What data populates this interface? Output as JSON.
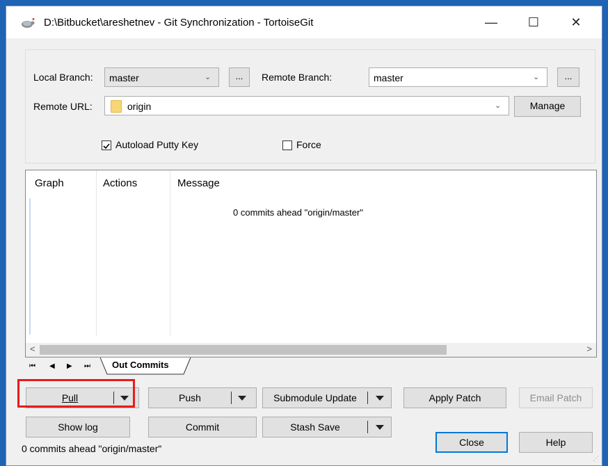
{
  "window": {
    "title": "D:\\Bitbucket\\areshetnev - Git Synchronization - TortoiseGit",
    "minimize_glyph": "—",
    "maximize_glyph": "☐",
    "close_glyph": "✕"
  },
  "form": {
    "local_branch_label": "Local Branch:",
    "local_branch_value": "master",
    "remote_branch_label": "Remote Branch:",
    "remote_branch_value": "master",
    "remote_url_label": "Remote URL:",
    "remote_url_value": "origin",
    "ellipsis_label": "...",
    "manage_label": "Manage",
    "autoload_label": "Autoload Putty Key",
    "autoload_checked": true,
    "force_label": "Force",
    "force_checked": false
  },
  "list": {
    "columns": [
      "Graph",
      "Actions",
      "Message"
    ],
    "empty_message": "0 commits ahead \"origin/master\""
  },
  "tabs": {
    "nav": [
      "⏮",
      "◀",
      "▶",
      "⏭"
    ],
    "active": "Out Commits"
  },
  "buttons": {
    "pull": "Pull",
    "push": "Push",
    "submodule_update": "Submodule Update",
    "apply_patch": "Apply Patch",
    "email_patch": "Email Patch",
    "show_log": "Show log",
    "commit": "Commit",
    "stash_save": "Stash Save",
    "close": "Close",
    "help": "Help"
  },
  "status": {
    "text": "0 commits ahead \"origin/master\""
  },
  "colors": {
    "highlight": "#e81b1b",
    "desktop": "#1e63b4"
  }
}
